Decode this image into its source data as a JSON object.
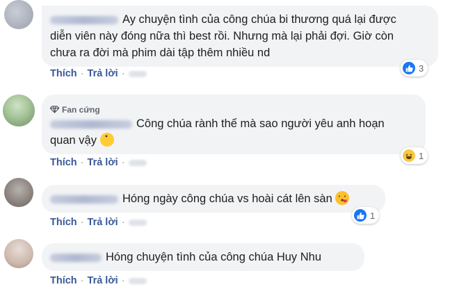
{
  "comments": [
    {
      "text_line1": "Ay chuyện tình của công chúa bi thương quá lại được",
      "text_line2": "diễn viên này đóng nữa thì best rồi. Nhưng mà lại phải đợi. Giờ còn",
      "text_line3": "chưa ra đời mà phim dài tập thêm nhiều nd",
      "reaction_icon": "like-icon",
      "reaction_count": "3"
    },
    {
      "badge": "Fan cứng",
      "badge_icon": "diamond-icon",
      "text_line1": "Công chúa rành thế mà sao người yêu anh hoạn",
      "text_line2": "quan vậy",
      "emoji": "pacman-emoji",
      "reaction_icon": "haha-icon",
      "reaction_count": "1"
    },
    {
      "text_line1": "Hóng ngày công chúa vs hoài cát lên sàn",
      "emoji": "kiss-emoji",
      "reaction_icon": "like-icon",
      "reaction_count": "1"
    },
    {
      "text_line1": "Hóng chuyện tình của công chúa Huy Nhu"
    }
  ],
  "actions": {
    "like": "Thích",
    "reply": "Trả lời",
    "separator": "·"
  },
  "colors": {
    "bubble": "#f2f3f5",
    "link": "#385898",
    "like_blue": "#1877f2",
    "haha_yellow": "#f7c844"
  }
}
